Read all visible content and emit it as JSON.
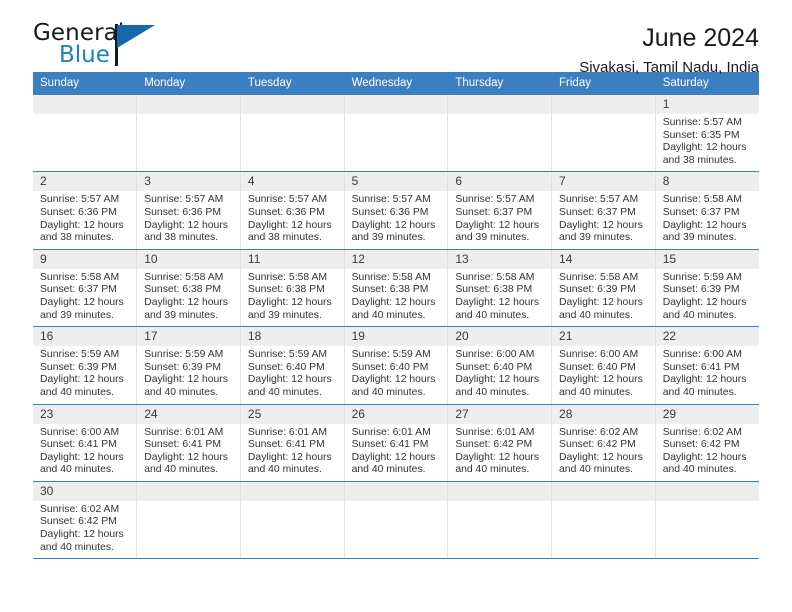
{
  "logo": {
    "word_one": "General",
    "word_two": "Blue",
    "icon": "triangle-flag-icon"
  },
  "header": {
    "title": "June 2024",
    "subtitle": "Sivakasi, Tamil Nadu, India"
  },
  "colors": {
    "header_blue": "#3c7fc1",
    "logo_blue": "#1f7ec4",
    "daynum_band": "#eeeeee",
    "cell_divider": "#e2e2e2"
  },
  "weekdays": [
    "Sunday",
    "Monday",
    "Tuesday",
    "Wednesday",
    "Thursday",
    "Friday",
    "Saturday"
  ],
  "weeks": [
    [
      {
        "day": "",
        "sunrise": "",
        "sunset": "",
        "daylight_line1": "",
        "daylight_line2": "",
        "empty": true
      },
      {
        "day": "",
        "sunrise": "",
        "sunset": "",
        "daylight_line1": "",
        "daylight_line2": "",
        "empty": true
      },
      {
        "day": "",
        "sunrise": "",
        "sunset": "",
        "daylight_line1": "",
        "daylight_line2": "",
        "empty": true
      },
      {
        "day": "",
        "sunrise": "",
        "sunset": "",
        "daylight_line1": "",
        "daylight_line2": "",
        "empty": true
      },
      {
        "day": "",
        "sunrise": "",
        "sunset": "",
        "daylight_line1": "",
        "daylight_line2": "",
        "empty": true
      },
      {
        "day": "",
        "sunrise": "",
        "sunset": "",
        "daylight_line1": "",
        "daylight_line2": "",
        "empty": true
      },
      {
        "day": "1",
        "sunrise": "Sunrise: 5:57 AM",
        "sunset": "Sunset: 6:35 PM",
        "daylight_line1": "Daylight: 12 hours",
        "daylight_line2": "and 38 minutes.",
        "empty": false
      }
    ],
    [
      {
        "day": "2",
        "sunrise": "Sunrise: 5:57 AM",
        "sunset": "Sunset: 6:36 PM",
        "daylight_line1": "Daylight: 12 hours",
        "daylight_line2": "and 38 minutes.",
        "empty": false
      },
      {
        "day": "3",
        "sunrise": "Sunrise: 5:57 AM",
        "sunset": "Sunset: 6:36 PM",
        "daylight_line1": "Daylight: 12 hours",
        "daylight_line2": "and 38 minutes.",
        "empty": false
      },
      {
        "day": "4",
        "sunrise": "Sunrise: 5:57 AM",
        "sunset": "Sunset: 6:36 PM",
        "daylight_line1": "Daylight: 12 hours",
        "daylight_line2": "and 38 minutes.",
        "empty": false
      },
      {
        "day": "5",
        "sunrise": "Sunrise: 5:57 AM",
        "sunset": "Sunset: 6:36 PM",
        "daylight_line1": "Daylight: 12 hours",
        "daylight_line2": "and 39 minutes.",
        "empty": false
      },
      {
        "day": "6",
        "sunrise": "Sunrise: 5:57 AM",
        "sunset": "Sunset: 6:37 PM",
        "daylight_line1": "Daylight: 12 hours",
        "daylight_line2": "and 39 minutes.",
        "empty": false
      },
      {
        "day": "7",
        "sunrise": "Sunrise: 5:57 AM",
        "sunset": "Sunset: 6:37 PM",
        "daylight_line1": "Daylight: 12 hours",
        "daylight_line2": "and 39 minutes.",
        "empty": false
      },
      {
        "day": "8",
        "sunrise": "Sunrise: 5:58 AM",
        "sunset": "Sunset: 6:37 PM",
        "daylight_line1": "Daylight: 12 hours",
        "daylight_line2": "and 39 minutes.",
        "empty": false
      }
    ],
    [
      {
        "day": "9",
        "sunrise": "Sunrise: 5:58 AM",
        "sunset": "Sunset: 6:37 PM",
        "daylight_line1": "Daylight: 12 hours",
        "daylight_line2": "and 39 minutes.",
        "empty": false
      },
      {
        "day": "10",
        "sunrise": "Sunrise: 5:58 AM",
        "sunset": "Sunset: 6:38 PM",
        "daylight_line1": "Daylight: 12 hours",
        "daylight_line2": "and 39 minutes.",
        "empty": false
      },
      {
        "day": "11",
        "sunrise": "Sunrise: 5:58 AM",
        "sunset": "Sunset: 6:38 PM",
        "daylight_line1": "Daylight: 12 hours",
        "daylight_line2": "and 39 minutes.",
        "empty": false
      },
      {
        "day": "12",
        "sunrise": "Sunrise: 5:58 AM",
        "sunset": "Sunset: 6:38 PM",
        "daylight_line1": "Daylight: 12 hours",
        "daylight_line2": "and 40 minutes.",
        "empty": false
      },
      {
        "day": "13",
        "sunrise": "Sunrise: 5:58 AM",
        "sunset": "Sunset: 6:38 PM",
        "daylight_line1": "Daylight: 12 hours",
        "daylight_line2": "and 40 minutes.",
        "empty": false
      },
      {
        "day": "14",
        "sunrise": "Sunrise: 5:58 AM",
        "sunset": "Sunset: 6:39 PM",
        "daylight_line1": "Daylight: 12 hours",
        "daylight_line2": "and 40 minutes.",
        "empty": false
      },
      {
        "day": "15",
        "sunrise": "Sunrise: 5:59 AM",
        "sunset": "Sunset: 6:39 PM",
        "daylight_line1": "Daylight: 12 hours",
        "daylight_line2": "and 40 minutes.",
        "empty": false
      }
    ],
    [
      {
        "day": "16",
        "sunrise": "Sunrise: 5:59 AM",
        "sunset": "Sunset: 6:39 PM",
        "daylight_line1": "Daylight: 12 hours",
        "daylight_line2": "and 40 minutes.",
        "empty": false
      },
      {
        "day": "17",
        "sunrise": "Sunrise: 5:59 AM",
        "sunset": "Sunset: 6:39 PM",
        "daylight_line1": "Daylight: 12 hours",
        "daylight_line2": "and 40 minutes.",
        "empty": false
      },
      {
        "day": "18",
        "sunrise": "Sunrise: 5:59 AM",
        "sunset": "Sunset: 6:40 PM",
        "daylight_line1": "Daylight: 12 hours",
        "daylight_line2": "and 40 minutes.",
        "empty": false
      },
      {
        "day": "19",
        "sunrise": "Sunrise: 5:59 AM",
        "sunset": "Sunset: 6:40 PM",
        "daylight_line1": "Daylight: 12 hours",
        "daylight_line2": "and 40 minutes.",
        "empty": false
      },
      {
        "day": "20",
        "sunrise": "Sunrise: 6:00 AM",
        "sunset": "Sunset: 6:40 PM",
        "daylight_line1": "Daylight: 12 hours",
        "daylight_line2": "and 40 minutes.",
        "empty": false
      },
      {
        "day": "21",
        "sunrise": "Sunrise: 6:00 AM",
        "sunset": "Sunset: 6:40 PM",
        "daylight_line1": "Daylight: 12 hours",
        "daylight_line2": "and 40 minutes.",
        "empty": false
      },
      {
        "day": "22",
        "sunrise": "Sunrise: 6:00 AM",
        "sunset": "Sunset: 6:41 PM",
        "daylight_line1": "Daylight: 12 hours",
        "daylight_line2": "and 40 minutes.",
        "empty": false
      }
    ],
    [
      {
        "day": "23",
        "sunrise": "Sunrise: 6:00 AM",
        "sunset": "Sunset: 6:41 PM",
        "daylight_line1": "Daylight: 12 hours",
        "daylight_line2": "and 40 minutes.",
        "empty": false
      },
      {
        "day": "24",
        "sunrise": "Sunrise: 6:01 AM",
        "sunset": "Sunset: 6:41 PM",
        "daylight_line1": "Daylight: 12 hours",
        "daylight_line2": "and 40 minutes.",
        "empty": false
      },
      {
        "day": "25",
        "sunrise": "Sunrise: 6:01 AM",
        "sunset": "Sunset: 6:41 PM",
        "daylight_line1": "Daylight: 12 hours",
        "daylight_line2": "and 40 minutes.",
        "empty": false
      },
      {
        "day": "26",
        "sunrise": "Sunrise: 6:01 AM",
        "sunset": "Sunset: 6:41 PM",
        "daylight_line1": "Daylight: 12 hours",
        "daylight_line2": "and 40 minutes.",
        "empty": false
      },
      {
        "day": "27",
        "sunrise": "Sunrise: 6:01 AM",
        "sunset": "Sunset: 6:42 PM",
        "daylight_line1": "Daylight: 12 hours",
        "daylight_line2": "and 40 minutes.",
        "empty": false
      },
      {
        "day": "28",
        "sunrise": "Sunrise: 6:02 AM",
        "sunset": "Sunset: 6:42 PM",
        "daylight_line1": "Daylight: 12 hours",
        "daylight_line2": "and 40 minutes.",
        "empty": false
      },
      {
        "day": "29",
        "sunrise": "Sunrise: 6:02 AM",
        "sunset": "Sunset: 6:42 PM",
        "daylight_line1": "Daylight: 12 hours",
        "daylight_line2": "and 40 minutes.",
        "empty": false
      }
    ],
    [
      {
        "day": "30",
        "sunrise": "Sunrise: 6:02 AM",
        "sunset": "Sunset: 6:42 PM",
        "daylight_line1": "Daylight: 12 hours",
        "daylight_line2": "and 40 minutes.",
        "empty": false
      },
      {
        "day": "",
        "sunrise": "",
        "sunset": "",
        "daylight_line1": "",
        "daylight_line2": "",
        "empty": true
      },
      {
        "day": "",
        "sunrise": "",
        "sunset": "",
        "daylight_line1": "",
        "daylight_line2": "",
        "empty": true
      },
      {
        "day": "",
        "sunrise": "",
        "sunset": "",
        "daylight_line1": "",
        "daylight_line2": "",
        "empty": true
      },
      {
        "day": "",
        "sunrise": "",
        "sunset": "",
        "daylight_line1": "",
        "daylight_line2": "",
        "empty": true
      },
      {
        "day": "",
        "sunrise": "",
        "sunset": "",
        "daylight_line1": "",
        "daylight_line2": "",
        "empty": true
      },
      {
        "day": "",
        "sunrise": "",
        "sunset": "",
        "daylight_line1": "",
        "daylight_line2": "",
        "empty": true
      }
    ]
  ]
}
